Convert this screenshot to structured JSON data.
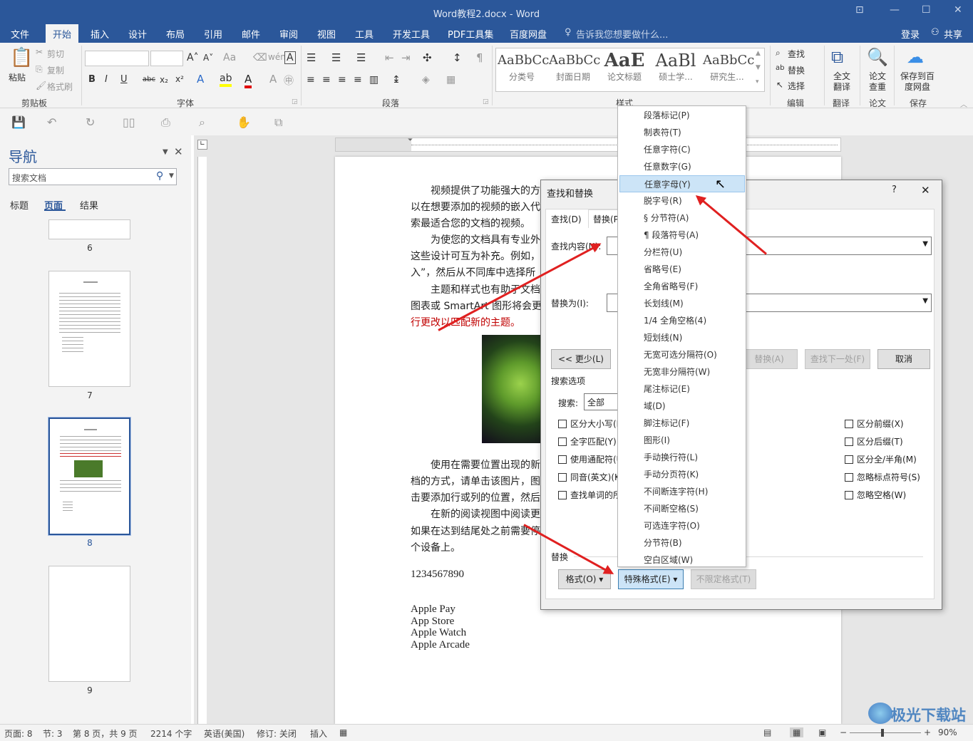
{
  "window": {
    "title": "Word教程2.docx - Word"
  },
  "menu": {
    "tabs": [
      "文件",
      "开始",
      "插入",
      "设计",
      "布局",
      "引用",
      "邮件",
      "审阅",
      "视图",
      "工具",
      "开发工具",
      "PDF工具集",
      "百度网盘"
    ],
    "tell": "告诉我您想要做什么...",
    "login": "登录",
    "share": "共享"
  },
  "ribbon": {
    "clipboard": {
      "paste": "粘贴",
      "cut": "剪切",
      "copy": "复制",
      "painter": "格式刷",
      "label": "剪贴板"
    },
    "font": {
      "label": "字体"
    },
    "paragraph": {
      "label": "段落"
    },
    "styles": {
      "label": "样式",
      "items": [
        {
          "preview": "AaBbCc",
          "name": "分类号"
        },
        {
          "preview": "AaBbCc",
          "name": "封面日期"
        },
        {
          "preview": "AaE",
          "name": "论文标题"
        },
        {
          "preview": "AaBl",
          "name": "硕士学..."
        },
        {
          "preview": "AaBbCc",
          "name": "研究生..."
        }
      ]
    },
    "edit": {
      "find": "查找",
      "replace": "替换",
      "select": "选择",
      "label": "编辑"
    },
    "translate": {
      "btn": "全文翻译",
      "label": "翻译"
    },
    "paper": {
      "btn": "论文查重",
      "label": "论文"
    },
    "save": {
      "btn": "保存到百度网盘",
      "label": "保存"
    }
  },
  "nav": {
    "title": "导航",
    "search_placeholder": "搜索文档",
    "tabs": [
      "标题",
      "页面",
      "结果"
    ],
    "pages": [
      "6",
      "7",
      "8",
      "9"
    ]
  },
  "doc": {
    "lines": [
      "视频提供了功能强大的方",
      "以在想要添加的视频的嵌入代",
      "索最适合您的文档的视频。",
      "为使您的文档具有专业外",
      "这些设计可互为补充。例如，",
      "入”，然后从不同库中选择所",
      "主题和样式也有助于文档",
      "图表或 SmartArt 图形将会更",
      "行更改以匹配新的主题。",
      "使用在需要位置出现的新",
      "档的方式，请单击该图片，图",
      "击要添加行或列的位置，然后",
      "在新的阅读视图中阅读更",
      "如果在达到结尾处之前需要停",
      "个设备上。"
    ],
    "number": "1234567890",
    "apple": [
      "Apple Pay",
      "App Store",
      "Apple Watch",
      "Apple Arcade"
    ]
  },
  "dialog": {
    "title": "查找和替换",
    "help": "?",
    "close": "✕",
    "tabs": {
      "find": "查找(D)",
      "replace": "替换(P)"
    },
    "find_label": "查找内容(N):",
    "replace_label": "替换为(I):",
    "less": "<< 更少(L)",
    "replace_all": "替换(A)",
    "find_next": "查找下一处(F)",
    "cancel": "取消",
    "search_options": "搜索选项",
    "search_label": "搜索:",
    "search_value": "全部",
    "checks_left": [
      "区分大小写(H)",
      "全字匹配(Y)",
      "使用通配符(U)",
      "同音(英文)(K)",
      "查找单词的所有形式(英文)(W)"
    ],
    "checks_right": [
      "区分前缀(X)",
      "区分后缀(T)",
      "区分全/半角(M)",
      "忽略标点符号(S)",
      "忽略空格(W)"
    ],
    "replace_section": "替换",
    "format_btn": "格式(O) ▾",
    "special_btn": "特殊格式(E) ▾",
    "noformat_btn": "不限定格式(T)"
  },
  "special_menu": {
    "items": [
      "段落标记(P)",
      "制表符(T)",
      "任意字符(C)",
      "任意数字(G)",
      "任意字母(Y)",
      "脱字号(R)",
      "§ 分节符(A)",
      "¶ 段落符号(A)",
      "分栏符(U)",
      "省略号(E)",
      "全角省略号(F)",
      "长划线(M)",
      "1/4 全角空格(4)",
      "短划线(N)",
      "无宽可选分隔符(O)",
      "无宽非分隔符(W)",
      "尾注标记(E)",
      "域(D)",
      "脚注标记(F)",
      "图形(I)",
      "手动换行符(L)",
      "手动分页符(K)",
      "不间断连字符(H)",
      "不间断空格(S)",
      "可选连字符(O)",
      "分节符(B)",
      "空白区域(W)"
    ],
    "highlighted": 4
  },
  "status": {
    "page": "页面: 8",
    "section": "节: 3",
    "pageof": "第 8 页，共 9 页",
    "words": "2214 个字",
    "lang": "英语(美国)",
    "revision": "修订: 关闭",
    "mode": "插入",
    "zoom": "90%"
  },
  "watermark": "极光下载站"
}
